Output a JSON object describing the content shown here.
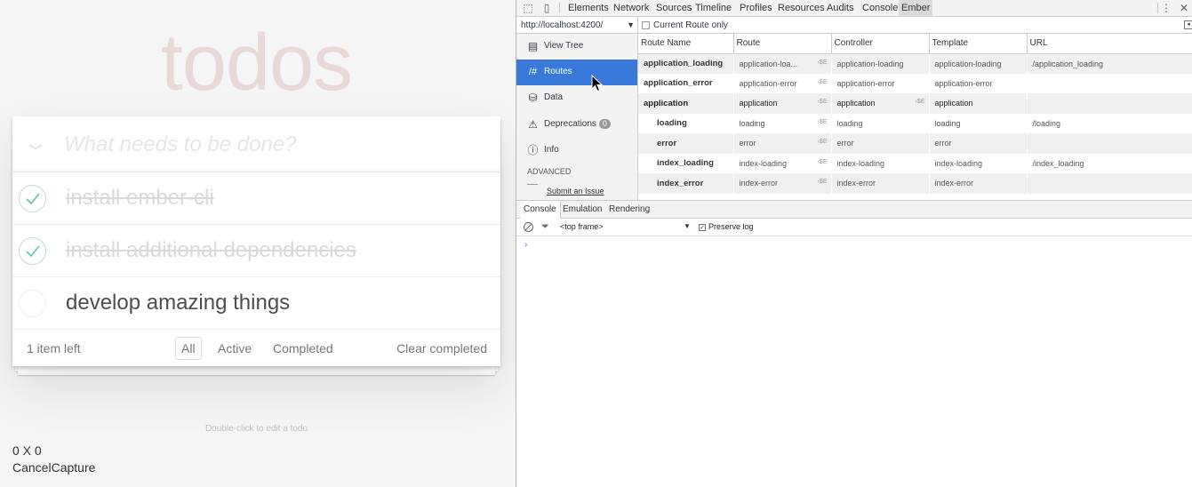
{
  "todo": {
    "title": "todos",
    "new_placeholder": "What needs to be done?",
    "items": [
      {
        "label": "install ember-cli",
        "completed": true
      },
      {
        "label": "install additional dependencies",
        "completed": true
      },
      {
        "label": "develop amazing things",
        "completed": false
      }
    ],
    "footer": {
      "items_left": "1 item left",
      "filters": [
        "All",
        "Active",
        "Completed"
      ],
      "selected_filter": "All",
      "clear_completed": "Clear completed"
    },
    "edit_hint": "Double-click to edit a todo",
    "capture_coords": "0 X 0",
    "capture_actions": "CancelCapture"
  },
  "devtools": {
    "tabs": [
      "Elements",
      "Network",
      "Sources",
      "Timeline",
      "Profiles",
      "Resources",
      "Audits",
      "Console",
      "Ember"
    ],
    "active_tab": "Ember",
    "url_select": "http://localhost:4200/",
    "current_route_only": "Current Route only",
    "sidebar": {
      "items": [
        {
          "label": "View Tree",
          "icon": "view-tree-icon"
        },
        {
          "label": "Routes",
          "icon": "routes-icon"
        },
        {
          "label": "Data",
          "icon": "data-icon"
        },
        {
          "label": "Deprecations",
          "icon": "warning-icon",
          "badge": "0"
        },
        {
          "label": "Info",
          "icon": "info-icon"
        }
      ],
      "active_item": "Routes",
      "advanced_label": "ADVANCED",
      "submit_issue": "Submit an Issue"
    },
    "routes": {
      "columns": [
        "Route Name",
        "Route",
        "Controller",
        "Template",
        "URL"
      ],
      "rows": [
        {
          "name": "application_loading",
          "route": "application-loa...",
          "controller": "application-loading",
          "template": "application-loading",
          "url": "/application_loading",
          "indent": 0
        },
        {
          "name": "application_error",
          "route": "application-error",
          "controller": "application-error",
          "template": "application-error",
          "url": "",
          "indent": 0
        },
        {
          "name": "application",
          "route": "application",
          "controller": "application",
          "template": "application",
          "url": "",
          "indent": 0,
          "top": true
        },
        {
          "name": "loading",
          "route": "loading",
          "controller": "loading",
          "template": "loading",
          "url": "/loading",
          "indent": 1
        },
        {
          "name": "error",
          "route": "error",
          "controller": "error",
          "template": "error",
          "url": "",
          "indent": 1
        },
        {
          "name": "index_loading",
          "route": "index-loading",
          "controller": "index-loading",
          "template": "index-loading",
          "url": "/index_loading",
          "indent": 1
        },
        {
          "name": "index_error",
          "route": "index-error",
          "controller": "index-error",
          "template": "index-error",
          "url": "",
          "indent": 1
        }
      ],
      "jump_glyph": "›$E"
    },
    "console": {
      "tabs": [
        "Console",
        "Emulation",
        "Rendering"
      ],
      "active_tab": "Console",
      "frame": "<top frame>",
      "preserve_log": "Preserve log",
      "prompt": "›"
    }
  },
  "colors": {
    "accent": "#3879d9",
    "todo_title": "#ead7d7",
    "check_green": "#5dc2af"
  }
}
